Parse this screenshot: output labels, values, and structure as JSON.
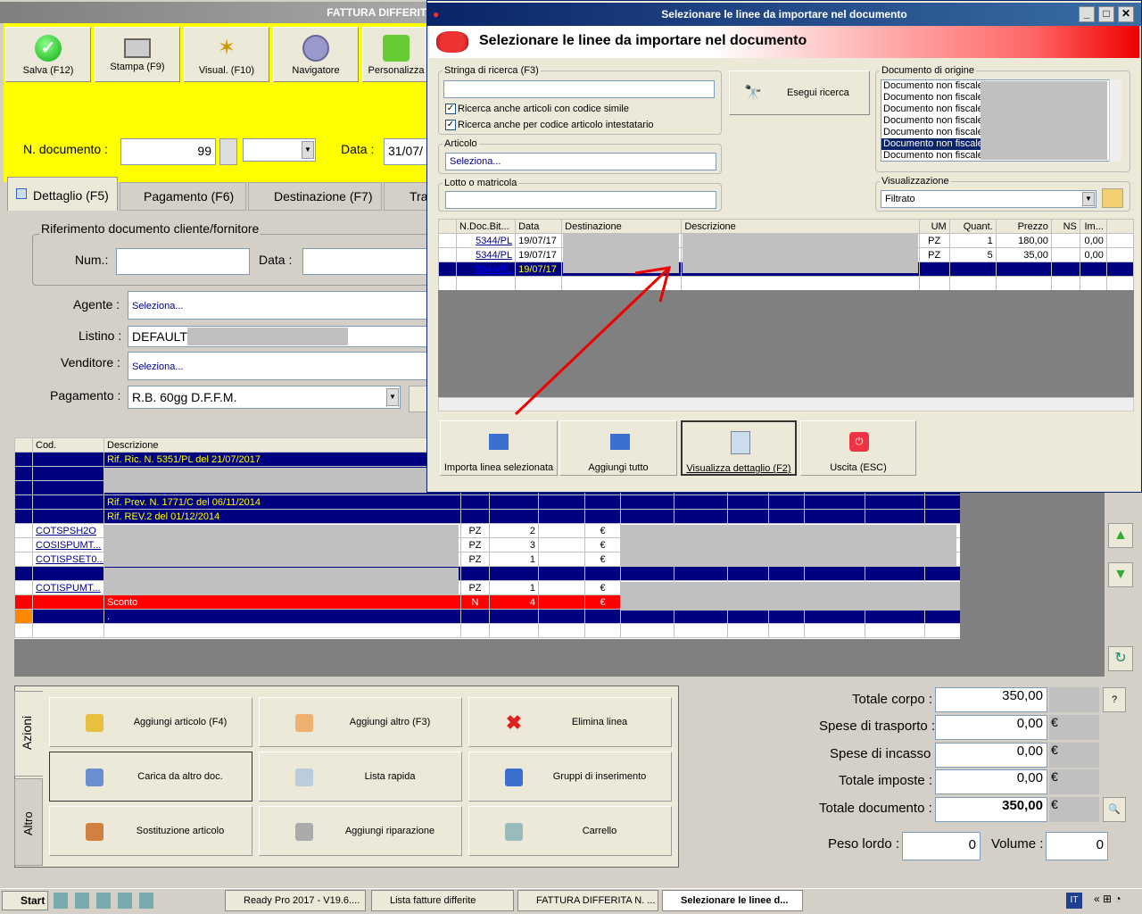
{
  "main_window": {
    "title": "FATTURA DIFFERITA",
    "toolbar": [
      "Salva (F12)",
      "Stampa (F9)",
      "Visual. (F10)",
      "Navigatore",
      "Personalizza"
    ],
    "doc_number_label": "N. documento :",
    "doc_number": "99",
    "date_label": "Data :",
    "date_value": "31/07/",
    "tabs": [
      "Dettaglio (F5)",
      "Pagamento (F6)",
      "Destinazione (F7)",
      "Tra"
    ],
    "ref_group_title": "Riferimento documento cliente/fornitore",
    "num_label": "Num.:",
    "data_label": "Data :",
    "agente_label": "Agente :",
    "agente_value": "Seleziona...",
    "listino_label": "Listino :",
    "listino_value": "DEFAULT",
    "venditore_label": "Venditore :",
    "venditore_value": "Seleziona...",
    "pagamento_label": "Pagamento :",
    "pagamento_value": "R.B. 60gg D.F.F.M."
  },
  "lines_grid": {
    "headers": [
      "Cod.",
      "Descrizione"
    ],
    "rows": [
      {
        "type": "navy",
        "cod": "",
        "desc": "Rif. Ric. N. 5351/PL del 21/07/2017",
        "um": "",
        "qty": "",
        "cur": ""
      },
      {
        "type": "navy",
        "cod": "",
        "desc": "",
        "um": "",
        "qty": "",
        "cur": ""
      },
      {
        "type": "navy",
        "cod": "",
        "desc": "",
        "um": "",
        "qty": "",
        "cur": ""
      },
      {
        "type": "navy",
        "cod": "",
        "desc": "Rif. Prev. N. 1771/C del 06/11/2014",
        "um": "",
        "qty": "",
        "cur": ""
      },
      {
        "type": "navy",
        "cod": "",
        "desc": "Rif. REV.2 del 01/12/2014",
        "um": "",
        "qty": "",
        "cur": ""
      },
      {
        "type": "item",
        "cod": "COTSPSH2O",
        "desc": "",
        "um": "PZ",
        "qty": "2",
        "cur": "€"
      },
      {
        "type": "item",
        "cod": "COSISPUMT...",
        "desc": "",
        "um": "PZ",
        "qty": "3",
        "cur": "€"
      },
      {
        "type": "item",
        "cod": "COTISPSET0...",
        "desc": "",
        "um": "PZ",
        "qty": "1",
        "cur": "€"
      },
      {
        "type": "navy",
        "cod": "",
        "desc": "",
        "um": "",
        "qty": "",
        "cur": ""
      },
      {
        "type": "item",
        "cod": "COTISPUMT...",
        "desc": "",
        "um": "PZ",
        "qty": "1",
        "cur": "€"
      },
      {
        "type": "red",
        "cod": "",
        "desc": "Sconto",
        "um": "N",
        "qty": "4",
        "cur": "€"
      },
      {
        "type": "navy",
        "cod": "",
        "desc": ".",
        "um": "",
        "qty": "",
        "cur": ""
      }
    ]
  },
  "actions": {
    "tab_azioni": "Azioni",
    "tab_altro": "Altro",
    "buttons": [
      "Aggiungi articolo (F4)",
      "Aggiungi altro (F3)",
      "Elimina linea",
      "Carica da altro doc.",
      "Lista rapida",
      "Gruppi di inserimento",
      "Sostituzione articolo",
      "Aggiungi riparazione",
      "Carrello"
    ]
  },
  "totals": {
    "totale_corpo_label": "Totale corpo :",
    "totale_corpo": "350,00",
    "spese_trasporto_label": "Spese di trasporto :",
    "spese_trasporto": "0,00",
    "spese_incasso_label": "Spese di incasso :",
    "spese_incasso": "0,00",
    "totale_imposte_label": "Totale imposte :",
    "totale_imposte": "0,00",
    "totale_documento_label": "Totale documento :",
    "totale_documento": "350,00",
    "currency": "€",
    "help": "?",
    "peso_lordo_label": "Peso lordo :",
    "peso_lordo": "0",
    "volume_label": "Volume :",
    "volume": "0"
  },
  "dialog": {
    "title": "Selezionare le linee da importare nel documento",
    "header": "Selezionare le linee da importare nel documento",
    "search_group": "Stringa di ricerca (F3)",
    "check1": "Ricerca anche articoli con codice simile",
    "check2": "Ricerca anche per codice articolo intestatario",
    "search_button": "Esegui ricerca",
    "articolo_group": "Articolo",
    "articolo_value": "Seleziona...",
    "lotto_group": "Lotto o matricola",
    "origin_group": "Documento di origine",
    "origin_items": [
      "Documento non fiscale",
      "Documento non fiscale",
      "Documento non fiscale",
      "Documento non fiscale",
      "Documento non fiscale",
      "Documento non fiscale",
      "Documento non fiscale"
    ],
    "view_group": "Visualizzazione",
    "view_value": "Filtrato",
    "grid_headers": [
      "N.Doc.Bit...",
      "Data",
      "Destinazione",
      "Descrizione",
      "UM",
      "Quant.",
      "Prezzo",
      "NS",
      "Im..."
    ],
    "grid_rows": [
      {
        "doc": "5344/PL",
        "date": "19/07/17",
        "um": "PZ",
        "qty": "1",
        "price": "180,00",
        "imp": "0,00"
      },
      {
        "doc": "5344/PL",
        "date": "19/07/17",
        "um": "PZ",
        "qty": "5",
        "price": "35,00",
        "imp": "0,00"
      },
      {
        "doc": "5344/PL",
        "date": "19/07/17",
        "um": "",
        "qty": "",
        "price": "",
        "imp": ""
      }
    ],
    "buttons": [
      "Importa linea selezionata",
      "Aggiungi tutto",
      "Visualizza dettaglio (F2)",
      "Uscita (ESC)"
    ]
  },
  "taskbar": {
    "start": "Start",
    "items": [
      "Ready Pro 2017 - V19.6....",
      "Lista fatture differite",
      "FATTURA DIFFERITA N. ...",
      "Selezionare le linee d..."
    ],
    "lang": "IT"
  }
}
